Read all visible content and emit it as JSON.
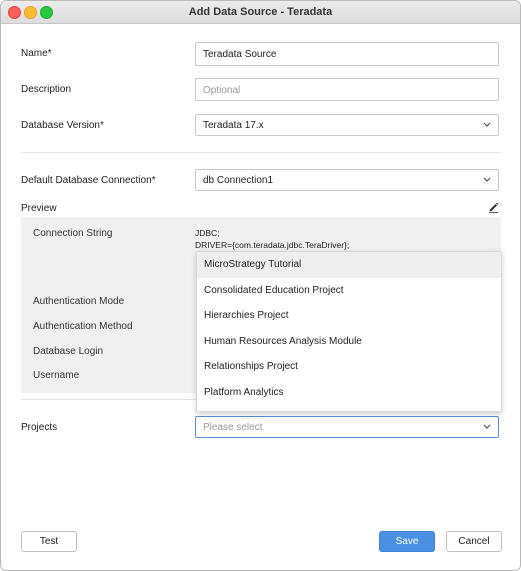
{
  "window": {
    "title": "Add Data Source - Teradata"
  },
  "form": {
    "name": {
      "label": "Name*",
      "value": "Teradata Source"
    },
    "description": {
      "label": "Description",
      "placeholder": "Optional"
    },
    "db_version": {
      "label": "Database Version*",
      "value": "Teradata 17.x"
    },
    "default_conn": {
      "label": "Default Database Connection*",
      "value": "db Connection1"
    },
    "projects": {
      "label": "Projects",
      "placeholder": "Please select"
    }
  },
  "preview": {
    "label": "Preview",
    "conn_string_label": "Connection String",
    "conn_string_line1": "JDBC;",
    "conn_string_line2": "DRIVER={com.teradata.jdbc.TeraDriver};",
    "auth_mode_label": "Authentication Mode",
    "auth_method_label": "Authentication Method",
    "db_login_label": "Database Login",
    "username_label": "Username"
  },
  "projects_dropdown": {
    "options": [
      "MicroStrategy Tutorial",
      "Consolidated Education Project",
      "Hierarchies Project",
      "Human Resources Analysis Module",
      "Relationships Project",
      "Platform Analytics"
    ],
    "highlighted": "MicroStrategy Tutorial"
  },
  "buttons": {
    "test": "Test",
    "save": "Save",
    "cancel": "Cancel"
  },
  "colors": {
    "primary": "#4a90e2",
    "highlight": "#efefef",
    "preview_bg": "#f0f0f0"
  }
}
